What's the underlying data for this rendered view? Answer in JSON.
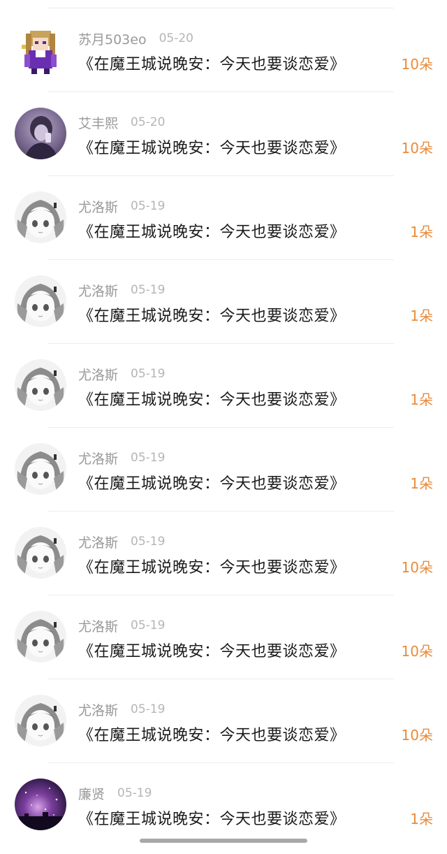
{
  "gifts": {
    "items": [
      {
        "user": "苏月503eo",
        "date": "05-20",
        "book": "《在魔王城说晚安：今天也要谈恋爱》",
        "amount": "10朵",
        "avatar": "pixel-girl-avatar"
      },
      {
        "user": "艾丰熙",
        "date": "05-20",
        "book": "《在魔王城说晚安：今天也要谈恋爱》",
        "amount": "10朵",
        "avatar": "purple-photo-avatar"
      },
      {
        "user": "尤洛斯",
        "date": "05-19",
        "book": "《在魔王城说晚安：今天也要谈恋爱》",
        "amount": "1朵",
        "avatar": "anime-girl-avatar"
      },
      {
        "user": "尤洛斯",
        "date": "05-19",
        "book": "《在魔王城说晚安：今天也要谈恋爱》",
        "amount": "1朵",
        "avatar": "anime-girl-avatar"
      },
      {
        "user": "尤洛斯",
        "date": "05-19",
        "book": "《在魔王城说晚安：今天也要谈恋爱》",
        "amount": "1朵",
        "avatar": "anime-girl-avatar"
      },
      {
        "user": "尤洛斯",
        "date": "05-19",
        "book": "《在魔王城说晚安：今天也要谈恋爱》",
        "amount": "1朵",
        "avatar": "anime-girl-avatar"
      },
      {
        "user": "尤洛斯",
        "date": "05-19",
        "book": "《在魔王城说晚安：今天也要谈恋爱》",
        "amount": "10朵",
        "avatar": "anime-girl-avatar"
      },
      {
        "user": "尤洛斯",
        "date": "05-19",
        "book": "《在魔王城说晚安：今天也要谈恋爱》",
        "amount": "10朵",
        "avatar": "anime-girl-avatar"
      },
      {
        "user": "尤洛斯",
        "date": "05-19",
        "book": "《在魔王城说晚安：今天也要谈恋爱》",
        "amount": "10朵",
        "avatar": "anime-girl-avatar"
      },
      {
        "user": "廉贤",
        "date": "05-19",
        "book": "《在魔王城说晚安：今天也要谈恋爱》",
        "amount": "1朵",
        "avatar": "galaxy-avatar"
      }
    ]
  },
  "colors": {
    "amount": "#e98b3a",
    "name": "#999999",
    "title": "#1a1a1a"
  }
}
